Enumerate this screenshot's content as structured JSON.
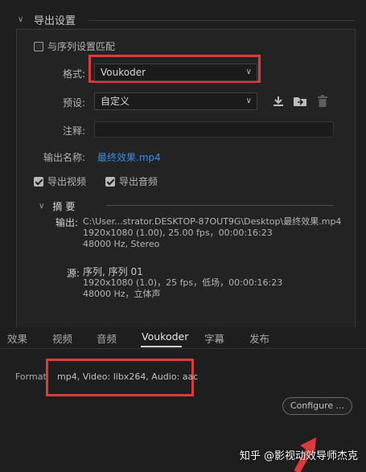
{
  "export_settings": {
    "section_title": "导出设置",
    "match_sequence_label": "与序列设置匹配",
    "format_label": "格式:",
    "format_value": "Voukoder",
    "preset_label": "预设:",
    "preset_value": "自定义",
    "comments_label": "注释:",
    "comments_value": "",
    "output_name_label": "输出名称:",
    "output_name_value": "最终效果.mp4",
    "export_video_label": "导出视频",
    "export_audio_label": "导出音频",
    "export_video_checked": true,
    "export_audio_checked": true,
    "match_sequence_checked": false
  },
  "summary": {
    "title": "摘要",
    "output_key": "输出:",
    "output_path": "C:\\User...strator.DESKTOP-87OUT9G\\Desktop\\最终效果.mp4",
    "output_video": "1920x1080 (1.00), 25.00 fps，00:00:16:23",
    "output_audio": "48000 Hz, Stereo",
    "source_key": "源:",
    "source_name": "序列, 序列 01",
    "source_video": "1920x1080 (1.0)，25 fps，低场，00:00:16:23",
    "source_audio": "48000 Hz，立体声"
  },
  "tabs": [
    {
      "label": "效果",
      "active": false
    },
    {
      "label": "视频",
      "active": false
    },
    {
      "label": "音频",
      "active": false
    },
    {
      "label": "Voukoder",
      "active": true
    },
    {
      "label": "字幕",
      "active": false
    },
    {
      "label": "发布",
      "active": false
    }
  ],
  "voukoder_panel": {
    "format_label": "Format",
    "format_value": "mp4, Video: libx264, Audio: aac",
    "configure_button": "Configure ..."
  },
  "watermark": "知乎 @影视动效导师杰克",
  "colors": {
    "highlight": "#e0393b",
    "link": "#3b8de0",
    "background": "#1e1e1e"
  }
}
